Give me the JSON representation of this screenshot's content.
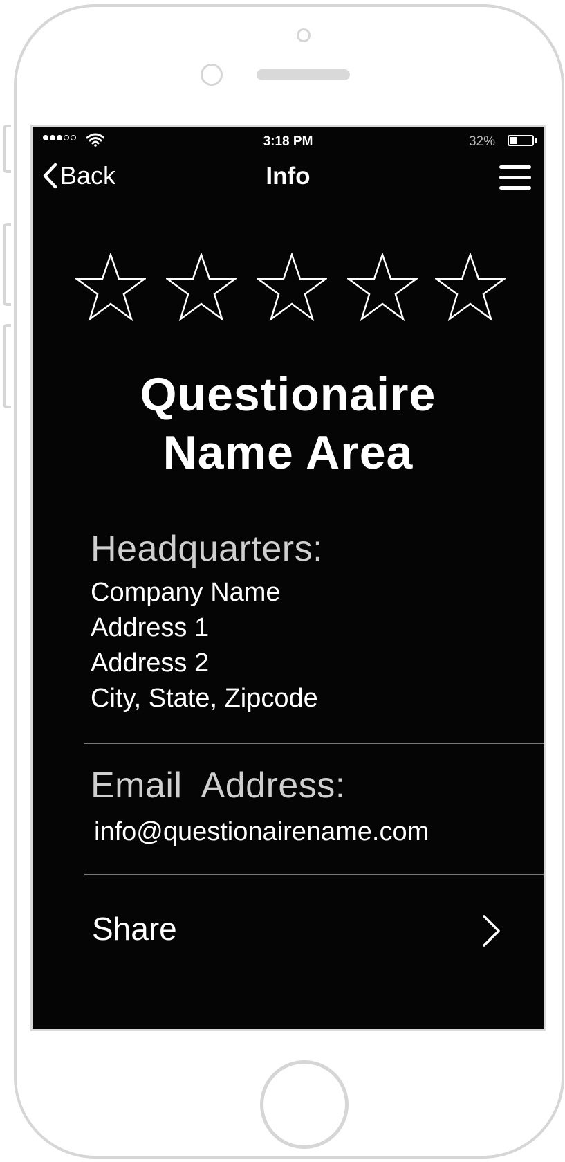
{
  "status_bar": {
    "time": "3:18 PM",
    "battery_percent": "32%",
    "battery_level": 0.32,
    "signal_bars": 3,
    "signal_total": 5
  },
  "nav": {
    "back_label": "Back",
    "title": "Info"
  },
  "rating": {
    "value": 0,
    "max": 5
  },
  "questionnaire": {
    "title_line1": "Questionaire",
    "title_line2": "Name Area"
  },
  "headquarters": {
    "label": "Headquarters:",
    "company": "Company Name",
    "address1": "Address 1",
    "address2": "Address 2",
    "city_state_zip": "City, State, Zipcode"
  },
  "email": {
    "label": "Email  Address:",
    "value": "info@questionairename.com"
  },
  "share": {
    "label": "Share"
  },
  "colors": {
    "screen_bg": "#050505",
    "text": "#ffffff",
    "label_gray": "#cfcfcf",
    "frame": "#d6d6d6"
  }
}
